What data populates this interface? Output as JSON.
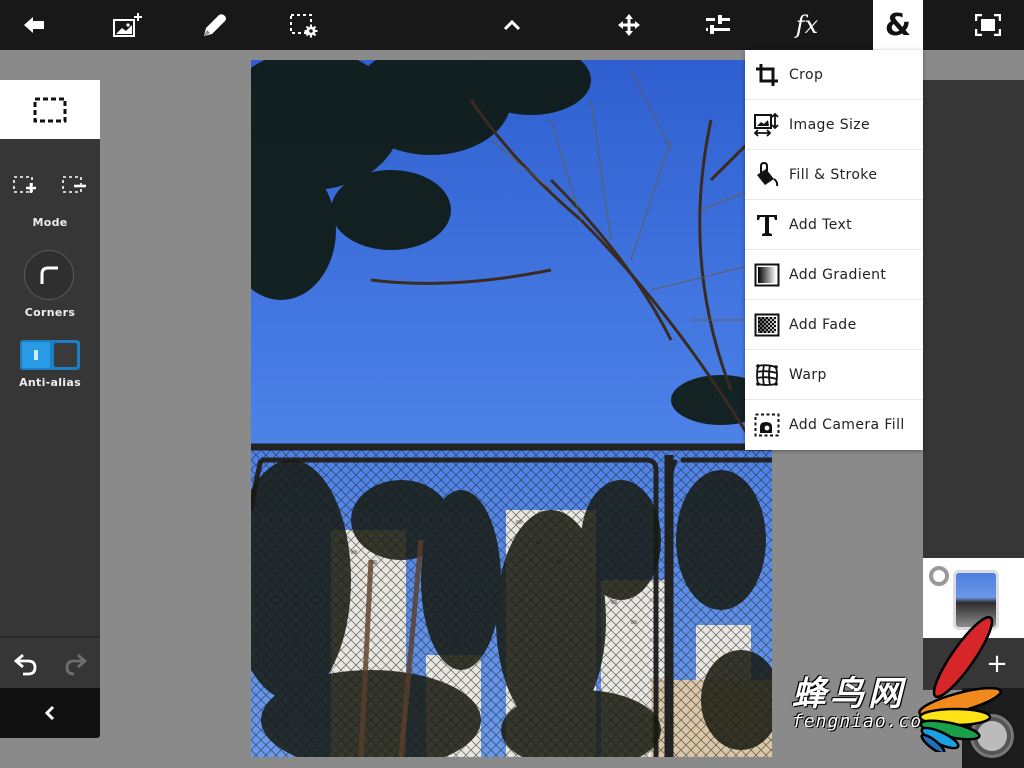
{
  "toolbar": {
    "back": "back-icon",
    "add_image": "add-image-icon",
    "draw": "pencil-icon",
    "selection_settings": "selection-settings-icon",
    "collapse": "chevron-up-icon",
    "move": "move-icon",
    "adjustments": "sliders-icon",
    "fx_label": "fx",
    "more_label": "&",
    "fullscreen": "fullscreen-icon",
    "active_item": "&"
  },
  "left_panel": {
    "selection_tool": "rectangle-select-icon",
    "mode_label": "Mode",
    "mode_add": "selection-add-icon",
    "mode_subtract": "selection-subtract-icon",
    "corners_label": "Corners",
    "antialias_label": "Anti-alias",
    "antialias_on": true,
    "undo": "undo-icon",
    "redo": "redo-icon",
    "redo_enabled": false,
    "collapse": "chevron-left-icon"
  },
  "menu": {
    "items": [
      {
        "label": "Crop",
        "icon": "crop-icon"
      },
      {
        "label": "Image Size",
        "icon": "image-size-icon"
      },
      {
        "label": "Fill & Stroke",
        "icon": "paint-bucket-icon"
      },
      {
        "label": "Add Text",
        "icon": "text-icon"
      },
      {
        "label": "Add Gradient",
        "icon": "gradient-icon"
      },
      {
        "label": "Add Fade",
        "icon": "fade-icon"
      },
      {
        "label": "Warp",
        "icon": "warp-icon"
      },
      {
        "label": "Add Camera Fill",
        "icon": "camera-fill-icon"
      }
    ]
  },
  "layers": {
    "add_label": "+",
    "selected": true
  },
  "watermark": {
    "cn": "蜂鸟网",
    "en": "fengniao.com"
  },
  "colors": {
    "topbar": "#181818",
    "panel": "#363636",
    "canvas_bg": "#8a8a8a",
    "toggle_blue": "#1c7fc4"
  }
}
